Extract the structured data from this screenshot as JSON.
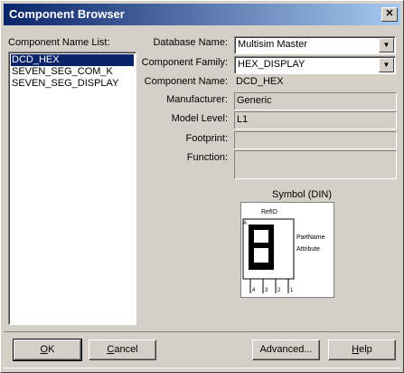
{
  "title": "Component Browser",
  "close_glyph": "✕",
  "labels": {
    "component_name_list": "Component Name List:",
    "database_name": "Database Name:",
    "component_family": "Component Family:",
    "component_name": "Component Name:",
    "manufacturer": "Manufacturer:",
    "model_level": "Model Level:",
    "footprint": "Footprint:",
    "function": "Function:",
    "symbol": "Symbol (DIN)"
  },
  "component_list": [
    "DCD_HEX",
    "SEVEN_SEG_COM_K",
    "SEVEN_SEG_DISPLAY"
  ],
  "selected_index": 0,
  "fields": {
    "database_name": "Multisim Master",
    "component_family": "HEX_DISPLAY",
    "component_name": "DCD_HEX",
    "manufacturer": "Generic",
    "model_level": "L1",
    "footprint": "",
    "function": ""
  },
  "symbol": {
    "refid": "RefID",
    "partname": "PartName",
    "attribute": "Attribute",
    "corner": "A",
    "pins": [
      "4",
      "3",
      "2",
      "1"
    ]
  },
  "buttons": {
    "ok_u": "O",
    "ok_rest": "K",
    "cancel_u": "C",
    "cancel_rest": "ancel",
    "advanced": "Advanced...",
    "help_u": "H",
    "help_rest": "elp"
  }
}
